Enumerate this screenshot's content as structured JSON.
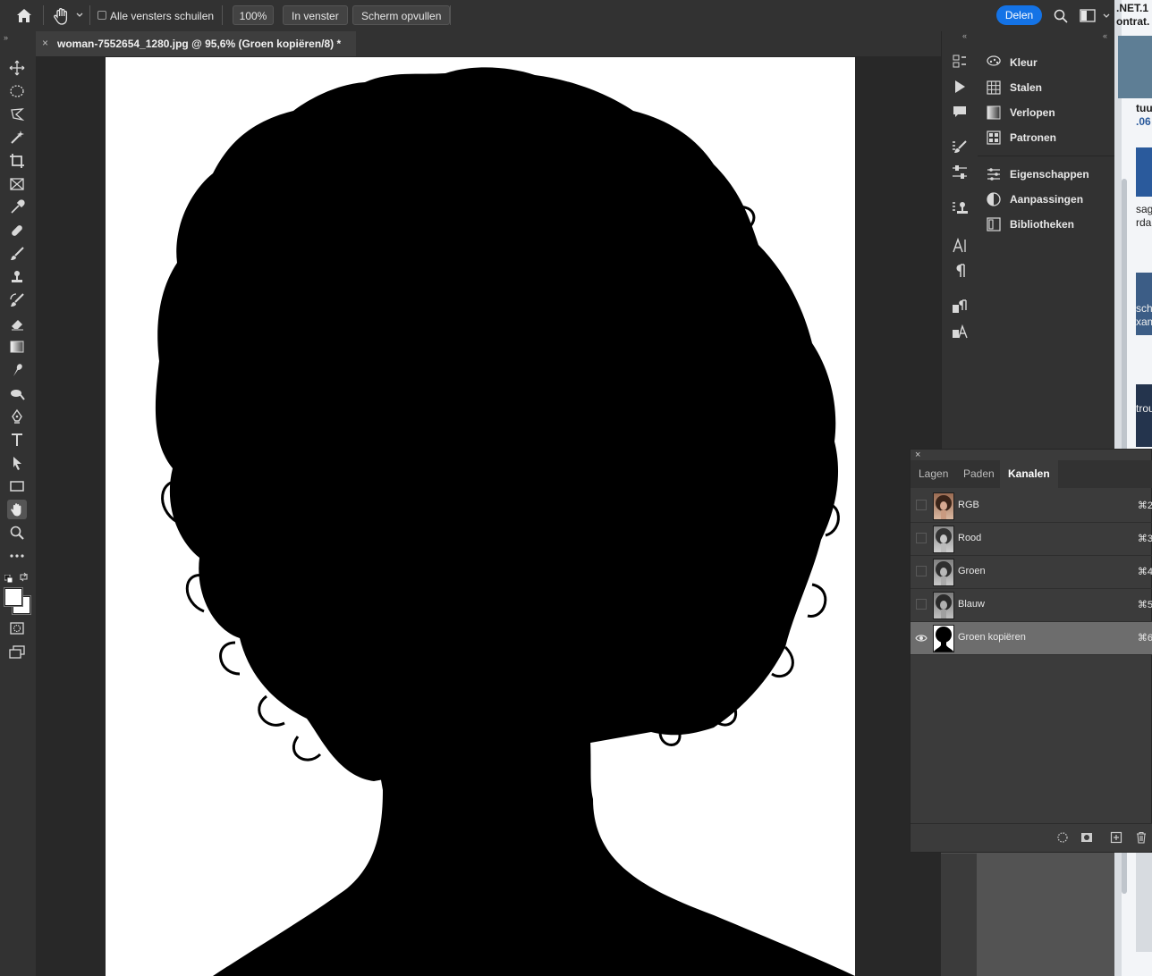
{
  "optionsbar": {
    "scroll_all_label": "Alle vensters schuilen",
    "zoom_100_label": "100%",
    "fit_screen_label": "In venster",
    "fill_screen_label": "Scherm opvullen",
    "share_label": "Delen"
  },
  "document": {
    "tab_title": "woman-7552654_1280.jpg @ 95,6% (Groen kopiëren/8) *",
    "tab_close": "×"
  },
  "panels": {
    "items": [
      {
        "label": "Kleur",
        "icon": "color-wheel-icon"
      },
      {
        "label": "Stalen",
        "icon": "swatches-grid-icon"
      },
      {
        "label": "Verlopen",
        "icon": "gradient-icon"
      },
      {
        "label": "Patronen",
        "icon": "patterns-icon"
      },
      {
        "label": "Eigenschappen",
        "icon": "sliders-icon"
      },
      {
        "label": "Aanpassingen",
        "icon": "adjustments-icon"
      },
      {
        "label": "Bibliotheken",
        "icon": "library-icon"
      }
    ]
  },
  "channels_panel": {
    "tabs": [
      "Lagen",
      "Paden",
      "Kanalen"
    ],
    "active_tab": "Kanalen",
    "rows": [
      {
        "name": "RGB",
        "shortcut": "⌘2",
        "visible": false
      },
      {
        "name": "Rood",
        "shortcut": "⌘3",
        "visible": false
      },
      {
        "name": "Groen",
        "shortcut": "⌘4",
        "visible": false
      },
      {
        "name": "Blauw",
        "shortcut": "⌘5",
        "visible": false
      },
      {
        "name": "Groen kopiëren",
        "shortcut": "⌘6",
        "visible": true,
        "selected": true
      }
    ]
  },
  "background_app": {
    "texts": [
      ".NET.1",
      "ontrat.",
      "tuur",
      ".06",
      "sag",
      "rda",
      "sch",
      "xam",
      "trou"
    ]
  },
  "colors": {
    "accent": "#1473e6",
    "panel_bg": "#323232",
    "canvas_bg": "#282828"
  }
}
